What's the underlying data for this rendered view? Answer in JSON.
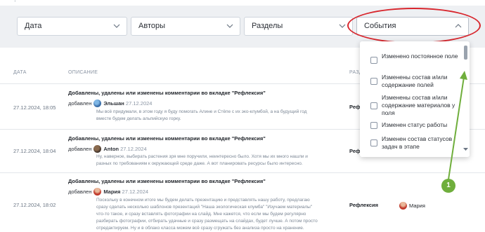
{
  "filters": {
    "date": "Дата",
    "authors": "Авторы",
    "sections": "Разделы",
    "events": "События"
  },
  "table": {
    "headers": {
      "date": "ДАТА",
      "description": "ОПИСАНИЕ",
      "section": "РАЗД"
    }
  },
  "rows": [
    {
      "date": "27.12.2024, 18:05",
      "title": "Добавлены, удалены или изменены комментарии во вкладке \"Рефлексия\"",
      "added_label": "добавлен",
      "user": "Эльшан",
      "added_date": "27.12.2024",
      "body": [
        "Мы всё придумали, в этом году я буду помогать Алине и Стёпе с их эко-клумбой, а на будущий год",
        "вместе будем делать альпийскую горку."
      ],
      "section": "Рефле"
    },
    {
      "date": "27.12.2024, 18:04",
      "title": "Добавлены, удалены или изменены комментарии во вкладке \"Рефлексия\"",
      "added_label": "добавлен",
      "user": "Anton",
      "added_date": "27.12.2024",
      "body": [
        "Ну, наверное, выбирать растения зря мне поручили, неинтересно было. Хотя мы их много нашли и",
        "разных по требованиям к окружающей среде даже. А вот планировать ресурсы было интересно."
      ],
      "section": "Рефле"
    },
    {
      "date": "27.12.2024, 18:02",
      "title": "Добавлены, удалены или изменены комментарии во вкладке \"Рефлексия\"",
      "added_label": "добавлен",
      "user": "Мария",
      "added_date": "27.12.2024",
      "body": [
        "Поскольку в конечном итоге мы будем делать презентацию и представлять нашу работу, предлагаю",
        "сразу сделать несколько шаблонов презентаций \"Наша экологическая клумба\" \"Изучаем материалы\"",
        "что-то такое, и сразу вставлять фотографии на слайд. Мне кажется, что если мы будем регулярно",
        "разбирать фотографии, отбирать удачные и сразу размещать на слайдах, будет лучше. А потом просто",
        "отредактируем. Ну и в облако класса можем всё сразу сгружать без анализа просто на хранение."
      ],
      "section": "Рефлексия",
      "author": "Мария"
    }
  ],
  "dropdown": {
    "items": [
      "Изменено постоянное поле",
      "Изменены состав и/или содержание полей",
      "Изменены состав и/или содержание материалов у поля",
      "Изменен статус работы",
      "Изменен состав статусов задач в этапе"
    ]
  },
  "annotation": {
    "badge": "1",
    "ellipse_color": "#d8262d",
    "arrow_color": "#6fae3c"
  }
}
